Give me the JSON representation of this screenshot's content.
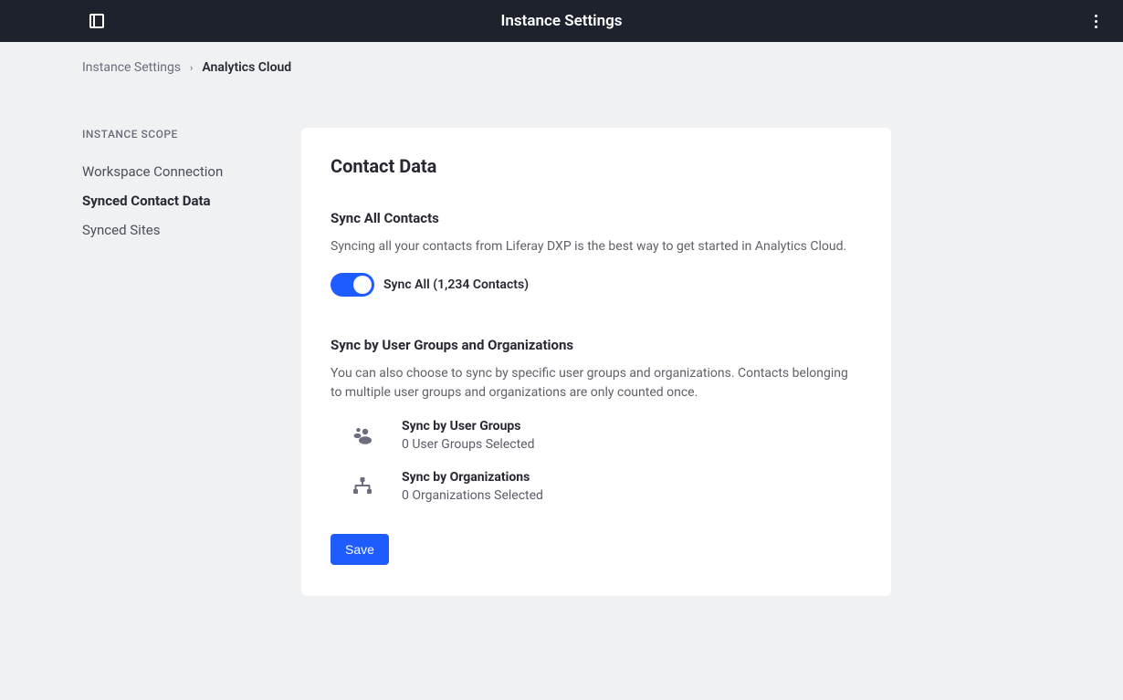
{
  "header": {
    "title": "Instance Settings"
  },
  "breadcrumb": {
    "parent": "Instance Settings",
    "current": "Analytics Cloud"
  },
  "sidebar": {
    "heading": "INSTANCE SCOPE",
    "items": [
      {
        "label": "Workspace Connection",
        "active": false
      },
      {
        "label": "Synced Contact Data",
        "active": true
      },
      {
        "label": "Synced Sites",
        "active": false
      }
    ]
  },
  "card": {
    "title": "Contact Data",
    "sync_all": {
      "heading": "Sync All Contacts",
      "description": "Syncing all your contacts from Liferay DXP is the best way to get started in Analytics Cloud.",
      "toggle_label": "Sync All (1,234 Contacts)"
    },
    "sync_by": {
      "heading": "Sync by User Groups and Organizations",
      "description": "You can also choose to sync by specific user groups and organizations. Contacts belonging to multiple user groups and organizations are only counted once.",
      "options": [
        {
          "title": "Sync by User Groups",
          "subtitle": "0 User Groups Selected"
        },
        {
          "title": "Sync by Organizations",
          "subtitle": "0 Organizations Selected"
        }
      ]
    },
    "save_label": "Save"
  }
}
